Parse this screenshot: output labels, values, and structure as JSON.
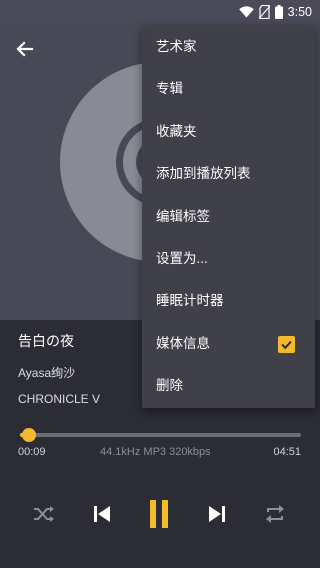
{
  "status_bar": {
    "time": "3:50"
  },
  "song": {
    "title": "告白の夜",
    "artist": "Ayasa绚沙",
    "album": "CHRONICLE V"
  },
  "player": {
    "elapsed": "00:09",
    "total": "04:51",
    "format": "44.1kHz  MP3  320kbps",
    "progress": 0.031,
    "state": "playing"
  },
  "menu": {
    "items": [
      {
        "label": "艺术家"
      },
      {
        "label": "专辑"
      },
      {
        "label": "收藏夹"
      },
      {
        "label": "添加到播放列表"
      },
      {
        "label": "编辑标签"
      },
      {
        "label": "设置为..."
      },
      {
        "label": "睡眠计时器"
      },
      {
        "label": "媒体信息",
        "checked": true
      },
      {
        "label": "删除"
      }
    ]
  },
  "colors": {
    "accent": "#f5b92e",
    "hero_bg": "#484957",
    "bg": "#2b2c34",
    "menu_bg": "#404049"
  },
  "icons": [
    "wifi-icon",
    "no-sim-icon",
    "battery-icon",
    "back-arrow-icon",
    "shuffle-icon",
    "previous-icon",
    "pause-icon",
    "next-icon",
    "repeat-icon",
    "checkbox-checked-icon"
  ]
}
